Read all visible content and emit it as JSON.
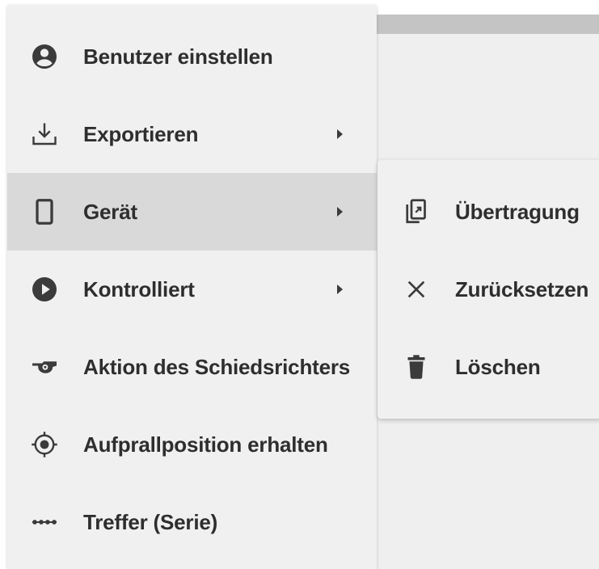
{
  "menu": {
    "items": [
      {
        "label": "Benutzer einstellen",
        "icon": "account-circle-icon",
        "has_submenu": false,
        "active": false
      },
      {
        "label": "Exportieren",
        "icon": "download-icon",
        "has_submenu": true,
        "active": false
      },
      {
        "label": "Gerät",
        "icon": "phone-device-icon",
        "has_submenu": true,
        "active": true
      },
      {
        "label": "Kontrolliert",
        "icon": "play-circle-icon",
        "has_submenu": true,
        "active": false
      },
      {
        "label": "Aktion des Schiedsrichters",
        "icon": "whistle-icon",
        "has_submenu": false,
        "active": false
      },
      {
        "label": "Aufprallposition erhalten",
        "icon": "crosshair-icon",
        "has_submenu": false,
        "active": false
      },
      {
        "label": "Treffer (Serie)",
        "icon": "dots-series-icon",
        "has_submenu": false,
        "active": false
      }
    ]
  },
  "submenu": {
    "items": [
      {
        "label": "Übertragung",
        "icon": "transfer-icon"
      },
      {
        "label": "Zurücksetzen",
        "icon": "close-icon"
      },
      {
        "label": "Löschen",
        "icon": "trash-icon"
      }
    ]
  },
  "colors": {
    "menu_bg": "#f0f0f0",
    "active_bg": "#d9d9d9",
    "text": "#2e2e2e",
    "icon": "#3b3b3b",
    "backdrop": "#efefef",
    "backdrop_bar": "#c4c4c4"
  }
}
